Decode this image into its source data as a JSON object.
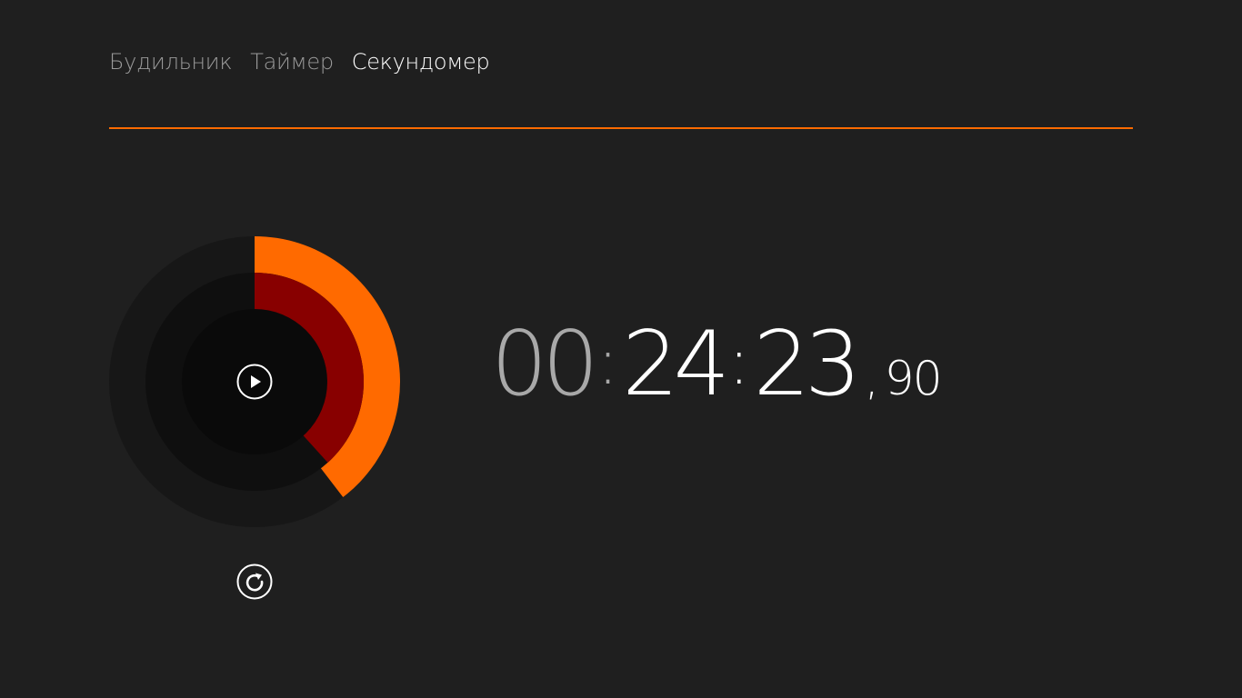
{
  "tabs": [
    {
      "label": "Будильник",
      "active": false
    },
    {
      "label": "Таймер",
      "active": false
    },
    {
      "label": "Секундомер",
      "active": true
    }
  ],
  "stopwatch": {
    "hours": "00",
    "minutes": "24",
    "seconds": "23",
    "decimal_separator": ",",
    "hundredths": "90",
    "time_separator": ":",
    "outer_ring_fraction": 0.396,
    "inner_ring_fraction": 0.383
  },
  "icons": {
    "play": "play-icon",
    "reset": "reset-icon"
  },
  "colors": {
    "background": "#1f1f1f",
    "accent": "#ff6a00",
    "inner_arc": "#880000",
    "outer_track": "#171717",
    "middle_track": "#0f0f0f",
    "center": "#0a0a0a"
  }
}
